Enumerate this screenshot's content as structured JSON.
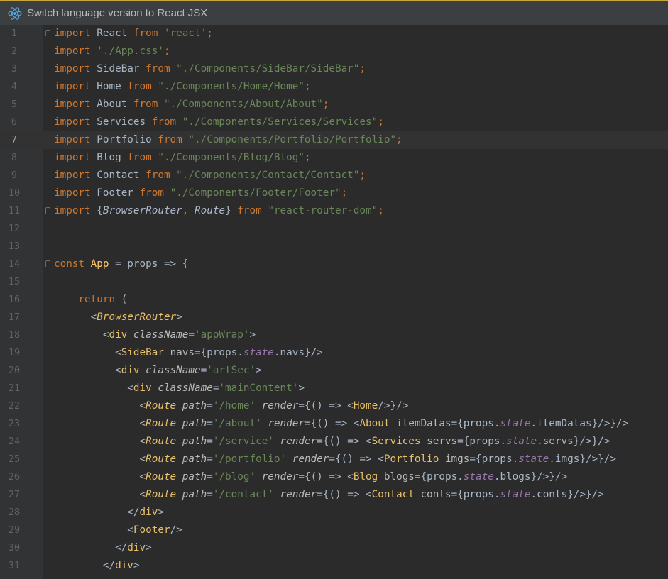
{
  "banner": {
    "icon": "react-icon",
    "label": "Switch language version to React JSX"
  },
  "editor": {
    "current_line": 7,
    "line_numbers": [
      "1",
      "2",
      "3",
      "4",
      "5",
      "6",
      "7",
      "8",
      "9",
      "10",
      "11",
      "12",
      "13",
      "14",
      "15",
      "16",
      "17",
      "18",
      "19",
      "20",
      "21",
      "22",
      "23",
      "24",
      "25",
      "26",
      "27",
      "28",
      "29",
      "30",
      "31"
    ],
    "lines": [
      [
        {
          "t": "import",
          "c": "k"
        },
        {
          "t": " React ",
          "c": "i"
        },
        {
          "t": "from",
          "c": "k"
        },
        {
          "t": " ",
          "c": "i"
        },
        {
          "t": "'react'",
          "c": "s"
        },
        {
          "t": ";",
          "c": "k"
        }
      ],
      [
        {
          "t": "import",
          "c": "k"
        },
        {
          "t": " ",
          "c": "i"
        },
        {
          "t": "'./App.css'",
          "c": "s"
        },
        {
          "t": ";",
          "c": "k"
        }
      ],
      [
        {
          "t": "import",
          "c": "k"
        },
        {
          "t": " SideBar ",
          "c": "i"
        },
        {
          "t": "from",
          "c": "k"
        },
        {
          "t": " ",
          "c": "i"
        },
        {
          "t": "\"./Components/SideBar/SideBar\"",
          "c": "s"
        },
        {
          "t": ";",
          "c": "k"
        }
      ],
      [
        {
          "t": "import",
          "c": "k"
        },
        {
          "t": " Home ",
          "c": "i"
        },
        {
          "t": "from",
          "c": "k"
        },
        {
          "t": " ",
          "c": "i"
        },
        {
          "t": "\"./Components/Home/Home\"",
          "c": "s"
        },
        {
          "t": ";",
          "c": "k"
        }
      ],
      [
        {
          "t": "import",
          "c": "k"
        },
        {
          "t": " About ",
          "c": "i"
        },
        {
          "t": "from",
          "c": "k"
        },
        {
          "t": " ",
          "c": "i"
        },
        {
          "t": "\"./Components/About/About\"",
          "c": "s"
        },
        {
          "t": ";",
          "c": "k"
        }
      ],
      [
        {
          "t": "import",
          "c": "k"
        },
        {
          "t": " Services ",
          "c": "i"
        },
        {
          "t": "from",
          "c": "k"
        },
        {
          "t": " ",
          "c": "i"
        },
        {
          "t": "\"./Components/Services/Services\"",
          "c": "s"
        },
        {
          "t": ";",
          "c": "k"
        }
      ],
      [
        {
          "t": "import",
          "c": "k"
        },
        {
          "t": " Portfolio ",
          "c": "i"
        },
        {
          "t": "from",
          "c": "k"
        },
        {
          "t": " ",
          "c": "i"
        },
        {
          "t": "\"./Components/Portfolio/Portfolio\"",
          "c": "s"
        },
        {
          "t": ";",
          "c": "k"
        }
      ],
      [
        {
          "t": "import",
          "c": "k"
        },
        {
          "t": " Blog ",
          "c": "i"
        },
        {
          "t": "from",
          "c": "k"
        },
        {
          "t": " ",
          "c": "i"
        },
        {
          "t": "\"./Components/Blog/Blog\"",
          "c": "s"
        },
        {
          "t": ";",
          "c": "k"
        }
      ],
      [
        {
          "t": "import",
          "c": "k"
        },
        {
          "t": " Contact ",
          "c": "i"
        },
        {
          "t": "from",
          "c": "k"
        },
        {
          "t": " ",
          "c": "i"
        },
        {
          "t": "\"./Components/Contact/Contact\"",
          "c": "s"
        },
        {
          "t": ";",
          "c": "k"
        }
      ],
      [
        {
          "t": "import",
          "c": "k"
        },
        {
          "t": " Footer ",
          "c": "i"
        },
        {
          "t": "from",
          "c": "k"
        },
        {
          "t": " ",
          "c": "i"
        },
        {
          "t": "\"./Components/Footer/Footer\"",
          "c": "s"
        },
        {
          "t": ";",
          "c": "k"
        }
      ],
      [
        {
          "t": "import",
          "c": "k"
        },
        {
          "t": " {",
          "c": "i"
        },
        {
          "t": "BrowserRouter",
          "c": "it"
        },
        {
          "t": ", ",
          "c": "k"
        },
        {
          "t": "Route",
          "c": "it"
        },
        {
          "t": "} ",
          "c": "i"
        },
        {
          "t": "from",
          "c": "k"
        },
        {
          "t": " ",
          "c": "i"
        },
        {
          "t": "\"react-router-dom\"",
          "c": "s"
        },
        {
          "t": ";",
          "c": "k"
        }
      ],
      [],
      [],
      [
        {
          "t": "const",
          "c": "k"
        },
        {
          "t": " ",
          "c": "i"
        },
        {
          "t": "App",
          "c": "f"
        },
        {
          "t": " = props => {",
          "c": "i"
        }
      ],
      [],
      [
        {
          "t": "    ",
          "c": "i"
        },
        {
          "t": "return",
          "c": "k"
        },
        {
          "t": " (",
          "c": "i"
        }
      ],
      [
        {
          "t": "      <",
          "c": "i"
        },
        {
          "t": "BrowserRouter",
          "c": "ti"
        },
        {
          "t": ">",
          "c": "i"
        }
      ],
      [
        {
          "t": "        <",
          "c": "i"
        },
        {
          "t": "div",
          "c": "t"
        },
        {
          "t": " ",
          "c": "i"
        },
        {
          "t": "className",
          "c": "ai"
        },
        {
          "t": "=",
          "c": "i"
        },
        {
          "t": "'appWrap'",
          "c": "s"
        },
        {
          "t": ">",
          "c": "i"
        }
      ],
      [
        {
          "t": "          <",
          "c": "i"
        },
        {
          "t": "SideBar",
          "c": "t"
        },
        {
          "t": " ",
          "c": "i"
        },
        {
          "t": "navs",
          "c": "a"
        },
        {
          "t": "={props.",
          "c": "i"
        },
        {
          "t": "state",
          "c": "pi"
        },
        {
          "t": ".navs}/>",
          "c": "i"
        }
      ],
      [
        {
          "t": "          <",
          "c": "i"
        },
        {
          "t": "div",
          "c": "t"
        },
        {
          "t": " ",
          "c": "i"
        },
        {
          "t": "className",
          "c": "ai"
        },
        {
          "t": "=",
          "c": "i"
        },
        {
          "t": "'artSec'",
          "c": "s"
        },
        {
          "t": ">",
          "c": "i"
        }
      ],
      [
        {
          "t": "            <",
          "c": "i"
        },
        {
          "t": "div",
          "c": "t"
        },
        {
          "t": " ",
          "c": "i"
        },
        {
          "t": "className",
          "c": "ai"
        },
        {
          "t": "=",
          "c": "i"
        },
        {
          "t": "'mainContent'",
          "c": "s"
        },
        {
          "t": ">",
          "c": "i"
        }
      ],
      [
        {
          "t": "              <",
          "c": "i"
        },
        {
          "t": "Route",
          "c": "ti"
        },
        {
          "t": " ",
          "c": "i"
        },
        {
          "t": "path",
          "c": "ai"
        },
        {
          "t": "=",
          "c": "i"
        },
        {
          "t": "'/home'",
          "c": "s"
        },
        {
          "t": " ",
          "c": "i"
        },
        {
          "t": "render",
          "c": "ai"
        },
        {
          "t": "={() => <",
          "c": "i"
        },
        {
          "t": "Home",
          "c": "t"
        },
        {
          "t": "/>}/>",
          "c": "i"
        }
      ],
      [
        {
          "t": "              <",
          "c": "i"
        },
        {
          "t": "Route",
          "c": "ti"
        },
        {
          "t": " ",
          "c": "i"
        },
        {
          "t": "path",
          "c": "ai"
        },
        {
          "t": "=",
          "c": "i"
        },
        {
          "t": "'/about'",
          "c": "s"
        },
        {
          "t": " ",
          "c": "i"
        },
        {
          "t": "render",
          "c": "ai"
        },
        {
          "t": "={() => <",
          "c": "i"
        },
        {
          "t": "About",
          "c": "t"
        },
        {
          "t": " ",
          "c": "i"
        },
        {
          "t": "itemDatas",
          "c": "a"
        },
        {
          "t": "={props.",
          "c": "i"
        },
        {
          "t": "state",
          "c": "pi"
        },
        {
          "t": ".itemDatas}/>}/>",
          "c": "i"
        }
      ],
      [
        {
          "t": "              <",
          "c": "i"
        },
        {
          "t": "Route",
          "c": "ti"
        },
        {
          "t": " ",
          "c": "i"
        },
        {
          "t": "path",
          "c": "ai"
        },
        {
          "t": "=",
          "c": "i"
        },
        {
          "t": "'/service'",
          "c": "s"
        },
        {
          "t": " ",
          "c": "i"
        },
        {
          "t": "render",
          "c": "ai"
        },
        {
          "t": "={() => <",
          "c": "i"
        },
        {
          "t": "Services",
          "c": "t"
        },
        {
          "t": " ",
          "c": "i"
        },
        {
          "t": "servs",
          "c": "a"
        },
        {
          "t": "={props.",
          "c": "i"
        },
        {
          "t": "state",
          "c": "pi"
        },
        {
          "t": ".servs}/>}/>",
          "c": "i"
        }
      ],
      [
        {
          "t": "              <",
          "c": "i"
        },
        {
          "t": "Route",
          "c": "ti"
        },
        {
          "t": " ",
          "c": "i"
        },
        {
          "t": "path",
          "c": "ai"
        },
        {
          "t": "=",
          "c": "i"
        },
        {
          "t": "'/portfolio'",
          "c": "s"
        },
        {
          "t": " ",
          "c": "i"
        },
        {
          "t": "render",
          "c": "ai"
        },
        {
          "t": "={() => <",
          "c": "i"
        },
        {
          "t": "Portfolio",
          "c": "t"
        },
        {
          "t": " ",
          "c": "i"
        },
        {
          "t": "imgs",
          "c": "a"
        },
        {
          "t": "={props.",
          "c": "i"
        },
        {
          "t": "state",
          "c": "pi"
        },
        {
          "t": ".imgs}/>}/>",
          "c": "i"
        }
      ],
      [
        {
          "t": "              <",
          "c": "i"
        },
        {
          "t": "Route",
          "c": "ti"
        },
        {
          "t": " ",
          "c": "i"
        },
        {
          "t": "path",
          "c": "ai"
        },
        {
          "t": "=",
          "c": "i"
        },
        {
          "t": "'/blog'",
          "c": "s"
        },
        {
          "t": " ",
          "c": "i"
        },
        {
          "t": "render",
          "c": "ai"
        },
        {
          "t": "={() => <",
          "c": "i"
        },
        {
          "t": "Blog",
          "c": "t"
        },
        {
          "t": " ",
          "c": "i"
        },
        {
          "t": "blogs",
          "c": "a"
        },
        {
          "t": "={props.",
          "c": "i"
        },
        {
          "t": "state",
          "c": "pi"
        },
        {
          "t": ".blogs}/>}/>",
          "c": "i"
        }
      ],
      [
        {
          "t": "              <",
          "c": "i"
        },
        {
          "t": "Route",
          "c": "ti"
        },
        {
          "t": " ",
          "c": "i"
        },
        {
          "t": "path",
          "c": "ai"
        },
        {
          "t": "=",
          "c": "i"
        },
        {
          "t": "'/contact'",
          "c": "s"
        },
        {
          "t": " ",
          "c": "i"
        },
        {
          "t": "render",
          "c": "ai"
        },
        {
          "t": "={() => <",
          "c": "i"
        },
        {
          "t": "Contact",
          "c": "t"
        },
        {
          "t": " ",
          "c": "i"
        },
        {
          "t": "conts",
          "c": "a"
        },
        {
          "t": "={props.",
          "c": "i"
        },
        {
          "t": "state",
          "c": "pi"
        },
        {
          "t": ".conts}/>}/>",
          "c": "i"
        }
      ],
      [
        {
          "t": "            </",
          "c": "i"
        },
        {
          "t": "div",
          "c": "t"
        },
        {
          "t": ">",
          "c": "i"
        }
      ],
      [
        {
          "t": "            <",
          "c": "i"
        },
        {
          "t": "Footer",
          "c": "t"
        },
        {
          "t": "/>",
          "c": "i"
        }
      ],
      [
        {
          "t": "          </",
          "c": "i"
        },
        {
          "t": "div",
          "c": "t"
        },
        {
          "t": ">",
          "c": "i"
        }
      ],
      [
        {
          "t": "        </",
          "c": "i"
        },
        {
          "t": "div",
          "c": "t"
        },
        {
          "t": ">",
          "c": "i"
        }
      ]
    ]
  }
}
